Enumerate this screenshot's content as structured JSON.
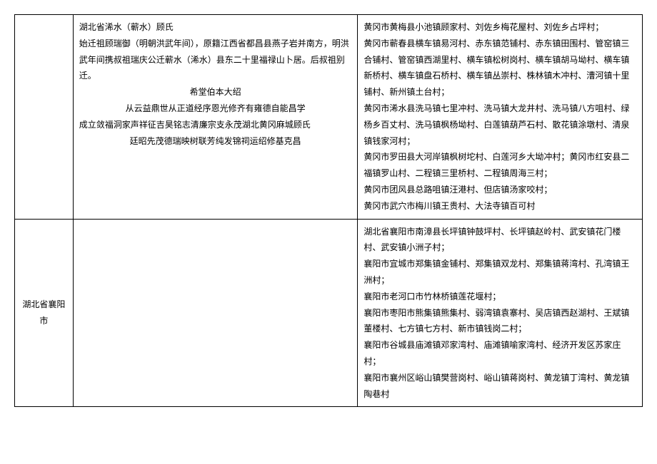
{
  "rows": [
    {
      "region": "",
      "desc": {
        "title": "湖北省浠水（蕲水）顾氏",
        "p1": "始迁祖顾瑞御（明朝洪武年间），原籍江西省都昌县燕子岩并南方，明洪武年间携叔祖瑞庆公迁蕲水（浠水）县东二十里福禄山卜居。后叔祖别迁。",
        "c1": "希堂伯本大绍",
        "c2": "从云益鼎世从正道经序恩光修齐有雍德自能昌学",
        "p2": "成立敛福洞家声祥征吉昊铭志清廉宗支永茂湖北黄冈麻城顾氏",
        "c3": "廷昭先茂德瑞映树联芳纯发锦祠运绍修基克昌"
      },
      "villages": [
        "黄冈市黄梅县小池镇顾家村、刘佐乡梅花屋村、刘佐乡占坪村；",
        "黄冈市蕲春县横车镇易河村、赤东镇范铺村、赤东镇田围村、管窑镇三合铺村、管窑镇西湖里村、横车镇松树岗村、横车镇胡马坳村、横车镇新桥村、横车镇盘石桥村、横车镇丛崇村、株林镇木冲村、漕河镇十里铺村、新州镇土台村；",
        "黄冈市浠水县洗马镇七里冲村、洗马镇大龙井村、洗马镇八方咀村、绿杨乡百丈村、洗马镇枫杨坳村、白莲镇葫芦石村、散花镇涂墩村、清泉镇钱家河村；",
        "黄冈市罗田县大河岸镇枫树坨村、白莲河乡大坳冲村；黄冈市红安县二福镇罗山村、二程镇三里桥村、二程镇周海三村；",
        "黄冈市团风县总路咀镇汪港村、但店镇汤家咬村；",
        "黄冈市武穴市梅川镇王贵村、大法寺镇百可村"
      ]
    },
    {
      "region": "湖北省襄阳市",
      "desc": {},
      "villages": [
        "湖北省襄阳市南漳县长坪镇钟鼓坪村、长坪镇赵岭村、武安镇花门楼村、武安镇小洲子村；",
        "襄阳市宜城市郑集镇金铺村、郑集镇双龙村、郑集镇蒋湾村、孔湾镇王洲村；",
        "襄阳市老河口市竹林桥镇莲花堰村；",
        "襄阳市枣阳市熊集镇熊集村、弱湾镇袁寨村、吴店镇西赵湖村、王斌镇董楼村、七方镇七方村、新市镇钱岗二村；",
        "襄阳市谷城县庙滩镇邓家湾村、庙滩镇喻家湾村、经济开发区苏家庄村；",
        "襄阳市襄州区峪山镇樊营岗村、峪山镇蒋岗村、黄龙镇丁湾村、黄龙镇陶巷村"
      ]
    }
  ]
}
